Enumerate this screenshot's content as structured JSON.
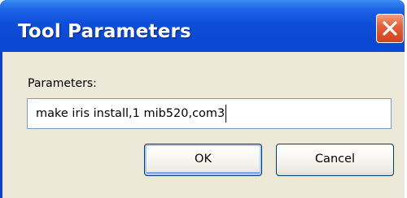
{
  "window": {
    "title": "Tool Parameters"
  },
  "form": {
    "label": "Parameters:",
    "value": "make iris install,1 mib520,com3"
  },
  "buttons": {
    "ok": "OK",
    "cancel": "Cancel"
  },
  "colors": {
    "titlebar": "#0a48d2",
    "client": "#ece9d8",
    "close_button": "#e5613a",
    "input_border": "#7f9db9",
    "button_border": "#003c74"
  },
  "icons": {
    "close": "close-icon"
  }
}
